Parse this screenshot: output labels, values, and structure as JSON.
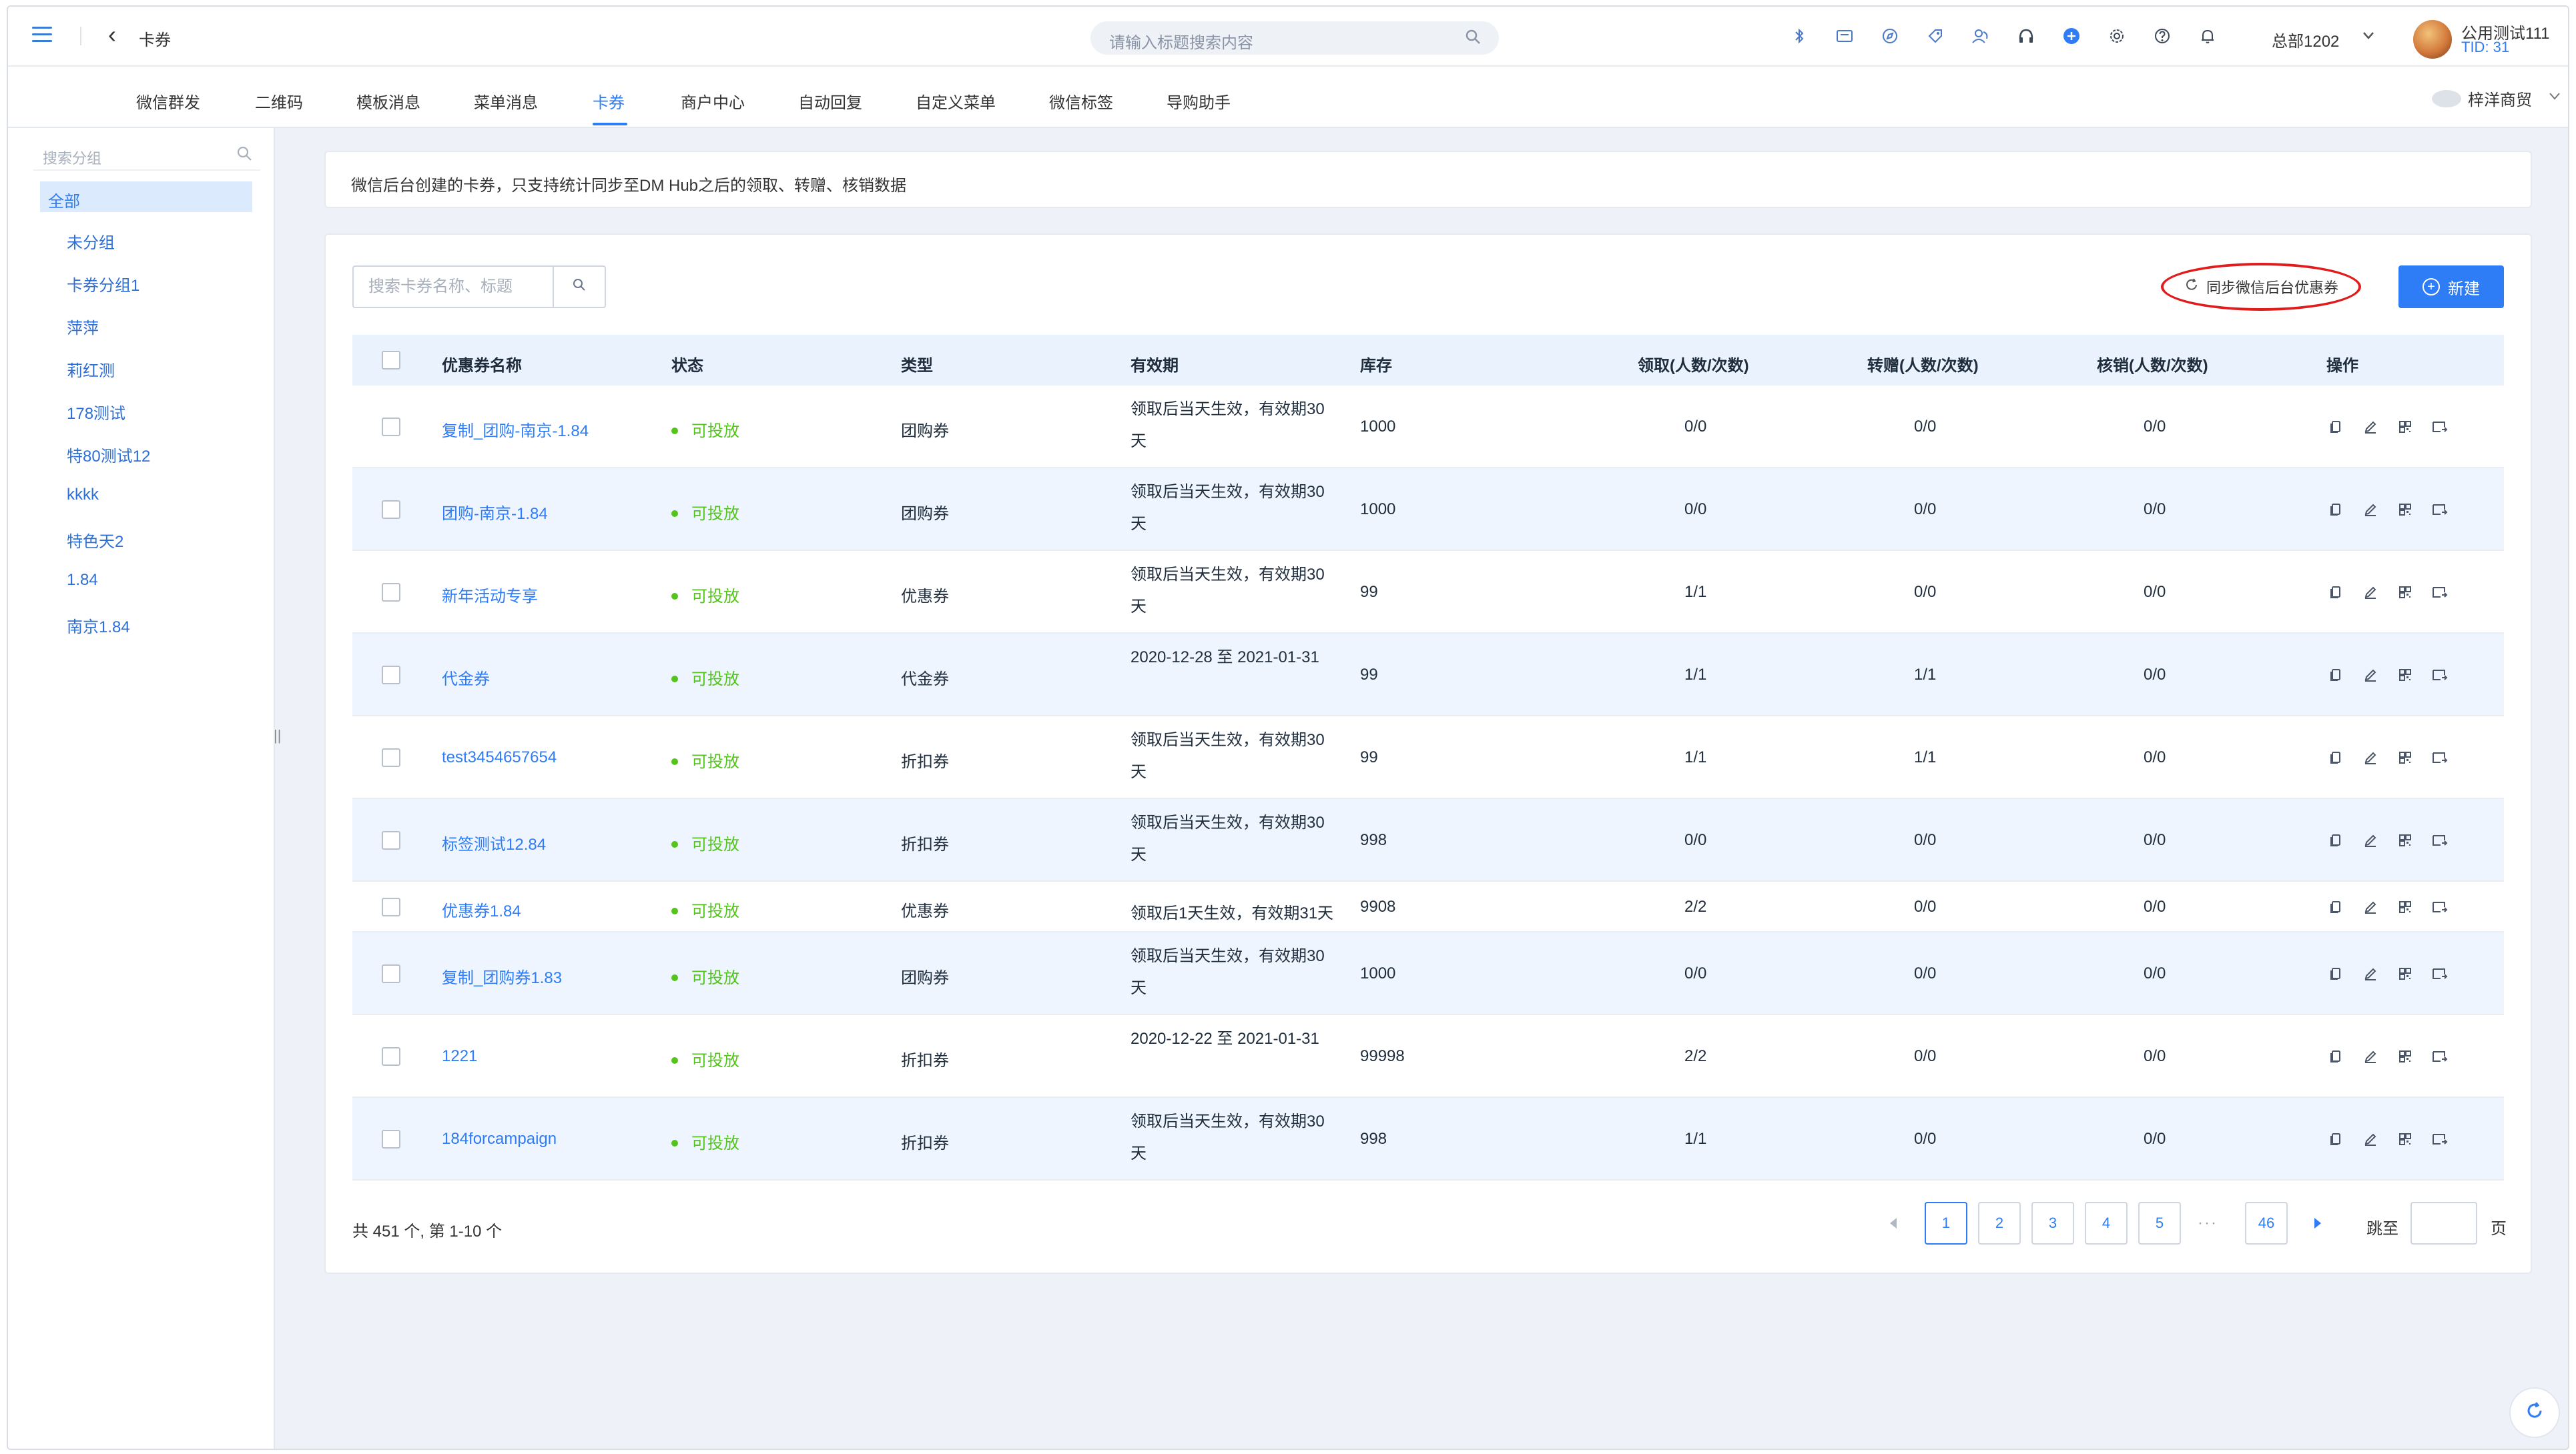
{
  "header": {
    "page_title": "卡券",
    "search_placeholder": "请输入标题搜索内容",
    "org": "总部1202",
    "user_name": "公用测试111",
    "user_tid": "TID: 31",
    "icons": [
      "bluetooth-icon",
      "message-icon",
      "compass-icon",
      "tag-icon",
      "users-icon",
      "headset-icon",
      "plus-circle-icon",
      "settings-icon",
      "help-icon",
      "bell-icon"
    ]
  },
  "nav": {
    "tabs": [
      {
        "label": "微信群发"
      },
      {
        "label": "二维码"
      },
      {
        "label": "模板消息"
      },
      {
        "label": "菜单消息"
      },
      {
        "label": "卡券"
      },
      {
        "label": "商户中心"
      },
      {
        "label": "自动回复"
      },
      {
        "label": "自定义菜单"
      },
      {
        "label": "微信标签"
      },
      {
        "label": "导购助手"
      }
    ],
    "active_tab": "卡券",
    "shop": "梓洋商贸"
  },
  "sidebar": {
    "search_placeholder": "搜索分组",
    "all_label": "全部",
    "items": [
      {
        "label": "未分组"
      },
      {
        "label": "卡券分组1"
      },
      {
        "label": "萍萍"
      },
      {
        "label": "莉红测"
      },
      {
        "label": "178测试"
      },
      {
        "label": "特80测试12"
      },
      {
        "label": "kkkk"
      },
      {
        "label": "特色天2"
      },
      {
        "label": "1.84"
      },
      {
        "label": "南京1.84"
      }
    ]
  },
  "notice": "微信后台创建的卡券，只支持统计同步至DM Hub之后的领取、转赠、核销数据",
  "toolbar": {
    "search_placeholder": "搜索卡券名称、标题",
    "sync_label": "同步微信后台优惠券",
    "new_label": "新建"
  },
  "table": {
    "columns": {
      "name": "优惠券名称",
      "status": "状态",
      "type": "类型",
      "validity": "有效期",
      "stock": "库存",
      "claim": "领取(人数/次数)",
      "transfer": "转赠(人数/次数)",
      "redeem": "核销(人数/次数)",
      "ops": "操作"
    },
    "rows": [
      {
        "name": "复制_团购-南京-1.84",
        "status": "可投放",
        "type": "团购券",
        "validity": "领取后当天生效，有效期30天",
        "stock": "1000",
        "claim": "0/0",
        "transfer": "0/0",
        "redeem": "0/0"
      },
      {
        "name": "团购-南京-1.84",
        "status": "可投放",
        "type": "团购券",
        "validity": "领取后当天生效，有效期30天",
        "stock": "1000",
        "claim": "0/0",
        "transfer": "0/0",
        "redeem": "0/0"
      },
      {
        "name": "新年活动专享",
        "status": "可投放",
        "type": "优惠券",
        "validity": "领取后当天生效，有效期30天",
        "stock": "99",
        "claim": "1/1",
        "transfer": "0/0",
        "redeem": "0/0"
      },
      {
        "name": "代金券",
        "status": "可投放",
        "type": "代金券",
        "validity": "2020-12-28 至 2021-01-31",
        "stock": "99",
        "claim": "1/1",
        "transfer": "1/1",
        "redeem": "0/0"
      },
      {
        "name": "test3454657654",
        "status": "可投放",
        "type": "折扣券",
        "validity": "领取后当天生效，有效期30天",
        "stock": "99",
        "claim": "1/1",
        "transfer": "1/1",
        "redeem": "0/0"
      },
      {
        "name": "标签测试12.84",
        "status": "可投放",
        "type": "折扣券",
        "validity": "领取后当天生效，有效期30天",
        "stock": "998",
        "claim": "0/0",
        "transfer": "0/0",
        "redeem": "0/0"
      },
      {
        "name": "优惠券1.84",
        "status": "可投放",
        "type": "优惠券",
        "validity": "领取后1天生效，有效期31天",
        "stock": "9908",
        "claim": "2/2",
        "transfer": "0/0",
        "redeem": "0/0"
      },
      {
        "name": "复制_团购券1.83",
        "status": "可投放",
        "type": "团购券",
        "validity": "领取后当天生效，有效期30天",
        "stock": "1000",
        "claim": "0/0",
        "transfer": "0/0",
        "redeem": "0/0"
      },
      {
        "name": "1221",
        "status": "可投放",
        "type": "折扣券",
        "validity": "2020-12-22 至 2021-01-31",
        "stock": "99998",
        "claim": "2/2",
        "transfer": "0/0",
        "redeem": "0/0"
      },
      {
        "name": "184forcampaign",
        "status": "可投放",
        "type": "折扣券",
        "validity": "领取后当天生效，有效期30天",
        "stock": "998",
        "claim": "1/1",
        "transfer": "0/0",
        "redeem": "0/0"
      }
    ],
    "op_icons": [
      "copy-icon",
      "edit-icon",
      "qrcode-icon",
      "send-icon"
    ]
  },
  "pagination": {
    "total_text": "共 451 个, 第 1-10 个",
    "pages": [
      "1",
      "2",
      "3",
      "4",
      "5"
    ],
    "ellipsis": "···",
    "last_page": "46",
    "current": "1",
    "jump_label": "跳至",
    "page_suffix": "页"
  },
  "colors": {
    "accent": "#2e7cf6",
    "status_green": "#52c41a",
    "highlight_ring": "#e01c1c"
  }
}
